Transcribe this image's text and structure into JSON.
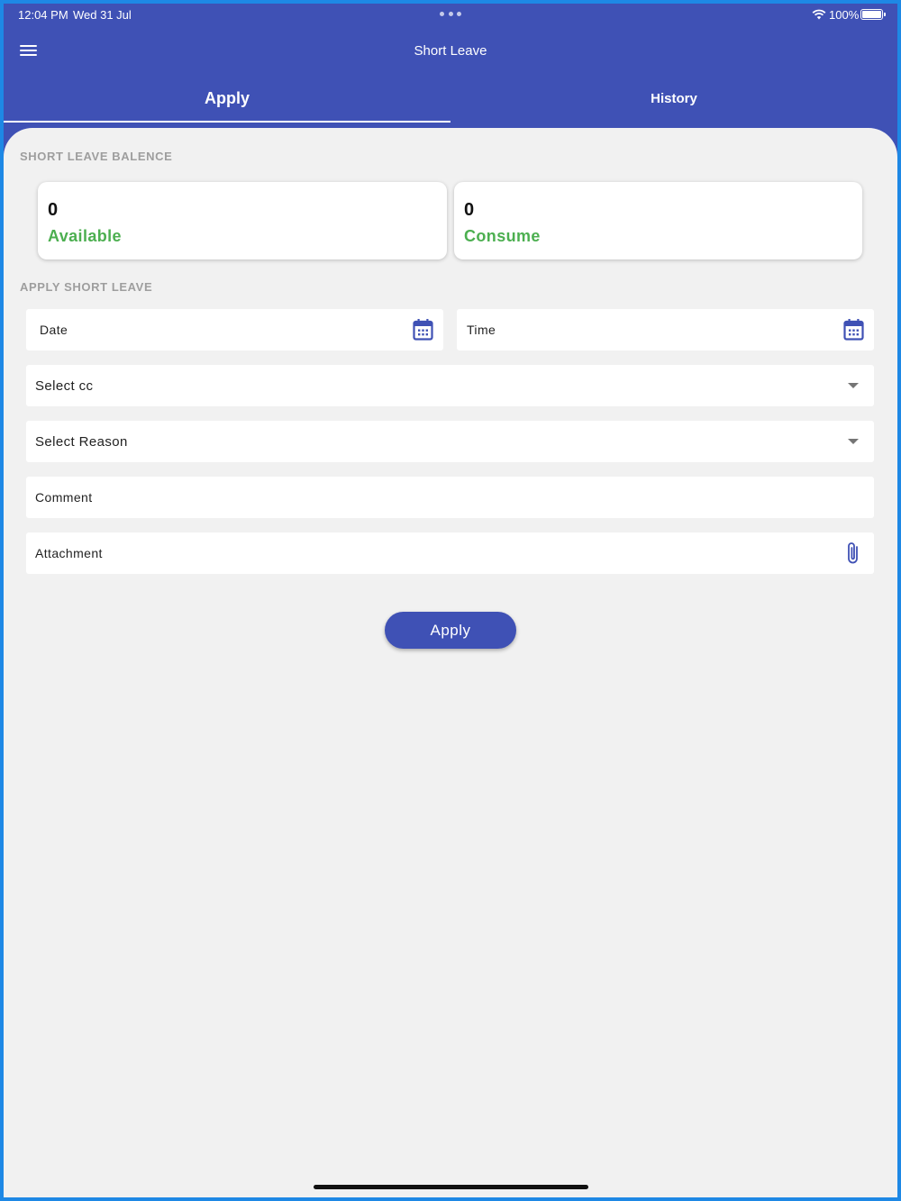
{
  "status_bar": {
    "time": "12:04 PM",
    "date": "Wed 31 Jul",
    "battery": "100%",
    "icons": [
      "wifi-icon",
      "battery-icon",
      "more-dots-icon"
    ]
  },
  "header": {
    "title": "Short Leave",
    "menu_icon": "hamburger-menu-icon"
  },
  "tabs": [
    {
      "label": "Apply",
      "active": true
    },
    {
      "label": "History",
      "active": false
    }
  ],
  "balance": {
    "section_title": "SHORT LEAVE BALENCE",
    "cards": [
      {
        "value": "0",
        "label": "Available"
      },
      {
        "value": "0",
        "label": "Consume"
      }
    ]
  },
  "form": {
    "section_title": "APPLY SHORT LEAVE",
    "date_label": "Date",
    "time_label": "Time",
    "cc_label": "Select cc",
    "reason_label": "Select Reason",
    "comment_label": "Comment",
    "attachment_label": "Attachment",
    "apply_label": "Apply",
    "icons": [
      "calendar-icon",
      "dropdown-caret-icon",
      "paperclip-icon"
    ]
  },
  "colors": {
    "primary": "#3f51b5",
    "accent_green": "#4caf50",
    "background": "#f1f1f1",
    "frame": "#1e88e5"
  }
}
